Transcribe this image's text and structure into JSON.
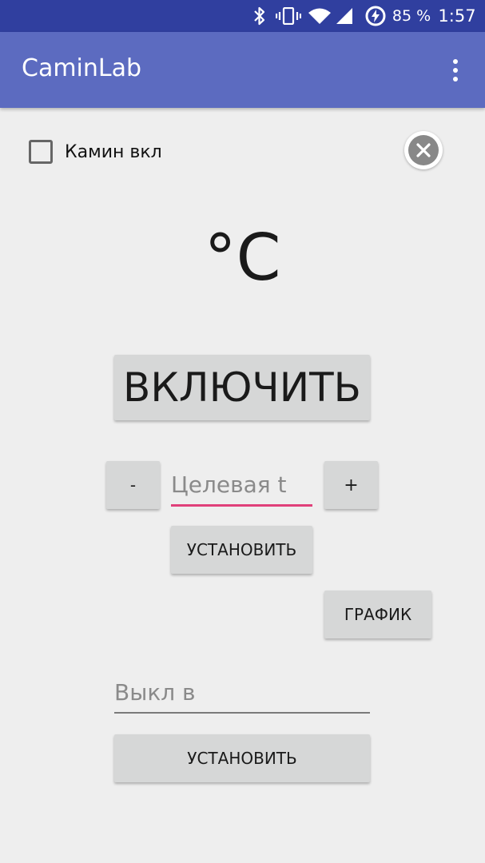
{
  "status_bar": {
    "battery_percent": "85 %",
    "time": "1:57",
    "icons": [
      "bluetooth-icon",
      "vibrate-icon",
      "wifi-icon",
      "cell-signal-icon",
      "battery-saver-icon"
    ]
  },
  "app_bar": {
    "title": "CaminLab",
    "menu_icon": "more-vert-icon"
  },
  "controls": {
    "fireplace_checkbox_label": "Камин вкл",
    "fireplace_checked": false,
    "close_icon": "close-circle-icon",
    "temperature_display": "°C",
    "power_button_label": "ВКЛЮЧИТЬ",
    "minus_label": "-",
    "plus_label": "+",
    "target_temp_placeholder": "Целевая t",
    "target_temp_value": "",
    "set_target_label": "УСТАНОВИТЬ",
    "chart_label": "ГРАФИК",
    "off_time_placeholder": "Выкл в",
    "off_time_value": "",
    "set_off_time_label": "УСТАНОВИТЬ"
  },
  "colors": {
    "status_bar": "#303f9f",
    "app_bar": "#5c6bc0",
    "accent": "#e0407a",
    "button": "#d6d7d7",
    "background": "#eeeeee"
  }
}
